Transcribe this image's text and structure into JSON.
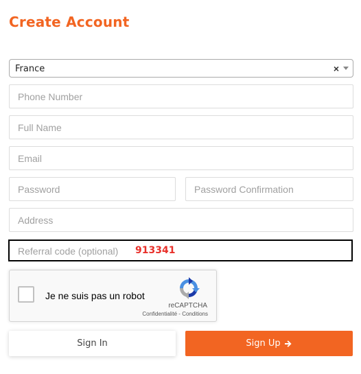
{
  "header": {
    "title": "Create Account"
  },
  "country_select": {
    "value": "France",
    "clear_symbol": "×"
  },
  "fields": {
    "phone": {
      "placeholder": "Phone Number",
      "value": ""
    },
    "full_name": {
      "placeholder": "Full Name",
      "value": ""
    },
    "email": {
      "placeholder": "Email",
      "value": ""
    },
    "password": {
      "placeholder": "Password",
      "value": ""
    },
    "password_confirmation": {
      "placeholder": "Password Confirmation",
      "value": ""
    },
    "address": {
      "placeholder": "Address",
      "value": ""
    }
  },
  "referral": {
    "placeholder": "Referral code (optional)",
    "code": "913341"
  },
  "recaptcha": {
    "label": "Je ne suis pas un robot",
    "brand": "reCAPTCHA",
    "privacy": "Confidentialité",
    "separator": " - ",
    "terms": "Conditions"
  },
  "buttons": {
    "sign_in": "Sign In",
    "sign_up": "Sign Up"
  },
  "colors": {
    "accent": "#f26522",
    "referral_code": "#e8302a"
  },
  "icons": [
    "chevron-down-icon",
    "close-icon",
    "recaptcha-logo-icon",
    "arrow-right-icon"
  ]
}
